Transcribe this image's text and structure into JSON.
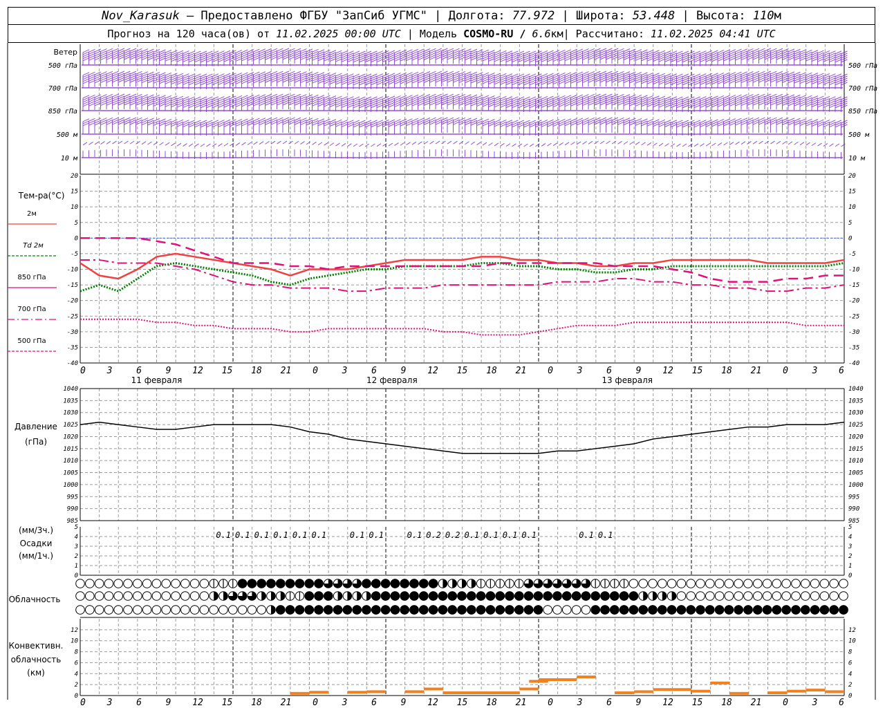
{
  "header": {
    "station": "Nov_Karasuk",
    "provider": "– Предоставлено ФГБУ \"ЗапСиб УГМС\" |",
    "lon_label": "Долгота:",
    "lon": "77.972",
    "lat_label": "| Широта:",
    "lat": "53.448",
    "alt_label": "| Высота:",
    "alt": "110",
    "alt_unit": "м",
    "forecast_label": "Прогноз на 120 часа(ов) от",
    "start": "11.02.2025 00:00 UTC",
    "model_label": " | Модель",
    "model": "COSMO-RU /",
    "resolution": "6.6",
    "res_unit": "км",
    "calc_label": " | Рассчитано:",
    "calc": "11.02.2025 04:41 UTC"
  },
  "colors": {
    "wind": "#7f2fd0",
    "t2m": "#f04040",
    "td2m": "#008000",
    "t850": "#e0107a",
    "t700": "#e0107a",
    "t500": "#e0107a",
    "pressure": "#000000",
    "precip": "#2040e0",
    "conv": "#f08020",
    "grid": "#9a9a9a",
    "zero_line": "#4060e0"
  },
  "chart_data": [
    {
      "type": "wind-barbs",
      "label": "Ветер",
      "levels": [
        {
          "name": "500 гПа",
          "dir_deg": 300,
          "speed_class": "strong"
        },
        {
          "name": "700 гПа",
          "dir_deg": 290,
          "speed_class": "strong"
        },
        {
          "name": "850 гПа",
          "dir_deg": 280,
          "speed_class": "strong"
        },
        {
          "name": "500 м",
          "dir_deg": 280,
          "speed_class": "moderate"
        },
        {
          "name": "10 м",
          "dir_deg": 250,
          "speed_class": "weak"
        }
      ]
    },
    {
      "type": "line",
      "ylabel": "Тем-ра(°С)",
      "ylim": [
        -40,
        20
      ],
      "yticks": [
        20,
        15,
        10,
        5,
        0,
        -5,
        -10,
        -15,
        -20,
        -25,
        -30,
        -35,
        -40
      ],
      "xlim": [
        0,
        120
      ],
      "xtick_labels": [
        "0",
        "3",
        "6",
        "9",
        "12",
        "15",
        "18",
        "21",
        "0",
        "3",
        "6",
        "9",
        "12",
        "15",
        "18",
        "21",
        "0",
        "3",
        "6",
        "9",
        "12",
        "15",
        "18",
        "21",
        "0",
        "3",
        "6"
      ],
      "day_labels": [
        "11 февраля",
        "12 февраля",
        "13 февраля"
      ],
      "series": [
        {
          "name": "2м",
          "style": "solid",
          "x": [
            0,
            3,
            6,
            9,
            12,
            15,
            18,
            21,
            24,
            27,
            30,
            33,
            36,
            39,
            42,
            45,
            48,
            51,
            54,
            57,
            60,
            63,
            66,
            69,
            72,
            75,
            78,
            81,
            84,
            87,
            90,
            93,
            96,
            99,
            102,
            105,
            108,
            111,
            114,
            117,
            120
          ],
          "y": [
            -8,
            -12,
            -13,
            -10,
            -6,
            -5,
            -6,
            -7,
            -8,
            -9,
            -10,
            -12,
            -10,
            -10,
            -10,
            -9,
            -8,
            -7,
            -7,
            -7,
            -7,
            -6,
            -6,
            -7,
            -7,
            -8,
            -8,
            -9,
            -9,
            -8,
            -8,
            -7,
            -7,
            -7,
            -7,
            -7,
            -8,
            -8,
            -8,
            -8,
            -7
          ]
        },
        {
          "name": "Td 2м",
          "style": "dotted",
          "x": [
            0,
            3,
            6,
            9,
            12,
            15,
            18,
            21,
            24,
            27,
            30,
            33,
            36,
            39,
            42,
            45,
            48,
            51,
            54,
            57,
            60,
            63,
            66,
            69,
            72,
            75,
            78,
            81,
            84,
            87,
            90,
            93,
            96,
            99,
            102,
            105,
            108,
            111,
            114,
            117,
            120
          ],
          "y": [
            -17,
            -15,
            -17,
            -13,
            -9,
            -8,
            -9,
            -10,
            -11,
            -12,
            -14,
            -15,
            -13,
            -12,
            -11,
            -10,
            -10,
            -9,
            -9,
            -9,
            -9,
            -8,
            -8,
            -9,
            -9,
            -10,
            -10,
            -11,
            -11,
            -10,
            -10,
            -9,
            -9,
            -9,
            -9,
            -9,
            -9,
            -9,
            -9,
            -9,
            -8
          ]
        },
        {
          "name": "850 гПа",
          "style": "dashed",
          "x": [
            0,
            3,
            6,
            9,
            12,
            15,
            18,
            21,
            24,
            27,
            30,
            33,
            36,
            39,
            42,
            45,
            48,
            51,
            54,
            57,
            60,
            63,
            66,
            69,
            72,
            75,
            78,
            81,
            84,
            87,
            90,
            93,
            96,
            99,
            102,
            105,
            108,
            111,
            114,
            117,
            120
          ],
          "y": [
            0,
            0,
            0,
            0,
            -1,
            -2,
            -4,
            -6,
            -8,
            -8,
            -8,
            -9,
            -9,
            -10,
            -9,
            -9,
            -9,
            -9,
            -9,
            -9,
            -9,
            -9,
            -8,
            -8,
            -8,
            -8,
            -8,
            -8,
            -9,
            -9,
            -9,
            -10,
            -11,
            -13,
            -14,
            -14,
            -14,
            -13,
            -13,
            -12,
            -12
          ]
        },
        {
          "name": "700 гПа",
          "style": "dashdot",
          "x": [
            0,
            3,
            6,
            9,
            12,
            15,
            18,
            21,
            24,
            27,
            30,
            33,
            36,
            39,
            42,
            45,
            48,
            51,
            54,
            57,
            60,
            63,
            66,
            69,
            72,
            75,
            78,
            81,
            84,
            87,
            90,
            93,
            96,
            99,
            102,
            105,
            108,
            111,
            114,
            117,
            120
          ],
          "y": [
            -7,
            -7,
            -8,
            -8,
            -8,
            -9,
            -10,
            -12,
            -14,
            -15,
            -15,
            -16,
            -16,
            -16,
            -17,
            -17,
            -16,
            -16,
            -16,
            -15,
            -15,
            -15,
            -15,
            -15,
            -15,
            -14,
            -14,
            -14,
            -13,
            -13,
            -14,
            -14,
            -15,
            -15,
            -16,
            -16,
            -17,
            -17,
            -16,
            -16,
            -15
          ]
        },
        {
          "name": "500 гПа",
          "style": "dotted",
          "x": [
            0,
            3,
            6,
            9,
            12,
            15,
            18,
            21,
            24,
            27,
            30,
            33,
            36,
            39,
            42,
            45,
            48,
            51,
            54,
            57,
            60,
            63,
            66,
            69,
            72,
            75,
            78,
            81,
            84,
            87,
            90,
            93,
            96,
            99,
            102,
            105,
            108,
            111,
            114,
            117,
            120
          ],
          "y": [
            -26,
            -26,
            -26,
            -26,
            -27,
            -27,
            -28,
            -28,
            -29,
            -29,
            -29,
            -30,
            -30,
            -29,
            -29,
            -29,
            -29,
            -29,
            -29,
            -30,
            -30,
            -31,
            -31,
            -31,
            -30,
            -29,
            -28,
            -28,
            -28,
            -27,
            -27,
            -27,
            -27,
            -27,
            -27,
            -27,
            -27,
            -27,
            -28,
            -28,
            -28
          ]
        }
      ]
    },
    {
      "type": "line",
      "ylabel": "Давление",
      "yunit": "(гПа)",
      "ylim": [
        985,
        1040
      ],
      "yticks": [
        1040,
        1035,
        1030,
        1025,
        1020,
        1015,
        1010,
        1005,
        1000,
        995,
        990,
        985
      ],
      "series": [
        {
          "name": "pressure",
          "x": [
            0,
            3,
            6,
            9,
            12,
            15,
            18,
            21,
            24,
            27,
            30,
            33,
            36,
            39,
            42,
            45,
            48,
            51,
            54,
            57,
            60,
            63,
            66,
            69,
            72,
            75,
            78,
            81,
            84,
            87,
            90,
            93,
            96,
            99,
            102,
            105,
            108,
            111,
            114,
            117,
            120
          ],
          "y": [
            1025,
            1026,
            1025,
            1024,
            1023,
            1023,
            1024,
            1025,
            1025,
            1025,
            1025,
            1024,
            1022,
            1021,
            1019,
            1018,
            1017,
            1016,
            1015,
            1014,
            1013,
            1013,
            1013,
            1013,
            1013,
            1014,
            1014,
            1015,
            1016,
            1017,
            1019,
            1020,
            1021,
            1022,
            1023,
            1024,
            1024,
            1025,
            1025,
            1025,
            1026
          ]
        }
      ]
    },
    {
      "type": "bar",
      "ylabel_top": "(мм/3ч.)",
      "ylabel": "Осадки",
      "ylabel_bottom": "(мм/1ч.)",
      "ylim": [
        0,
        5
      ],
      "yticks": [
        5,
        4,
        3,
        2,
        1,
        0
      ],
      "x": [
        21,
        24,
        27,
        30,
        33,
        36,
        42,
        45,
        51,
        54,
        57,
        60,
        63,
        66,
        69,
        78,
        81
      ],
      "values": [
        0.1,
        0.1,
        0.1,
        0.1,
        0.1,
        0.1,
        0.1,
        0.1,
        0.1,
        0.2,
        0.2,
        0.1,
        0.1,
        0.1,
        0.1,
        0.1,
        0.1
      ],
      "labels": [
        "0.1",
        "0.1",
        "0.1",
        "0.1",
        "0.1",
        "0.1",
        "0.1",
        "0.1",
        "0.1",
        "0.2",
        "0.2",
        "0.1",
        "0.1",
        "0.1",
        "0.1",
        "0.1",
        "0.1"
      ]
    },
    {
      "type": "cloud-cover",
      "ylabel": "Облачность",
      "rows": [
        "high",
        "middle",
        "low"
      ],
      "step_hours": 1.5,
      "segments": {
        "high": [
          [
            0,
            0,
            20
          ],
          [
            1,
            21,
            25
          ],
          [
            4,
            25,
            38
          ],
          [
            3,
            38,
            45
          ],
          [
            4,
            45,
            56
          ],
          [
            2,
            56,
            63
          ],
          [
            1,
            63,
            70
          ],
          [
            3,
            70,
            80
          ],
          [
            1,
            80,
            87
          ],
          [
            0,
            87,
            120
          ]
        ],
        "middle": [
          [
            0,
            0,
            20
          ],
          [
            2,
            20,
            24
          ],
          [
            3,
            24,
            28
          ],
          [
            2,
            28,
            33
          ],
          [
            1,
            33,
            36
          ],
          [
            4,
            36,
            40
          ],
          [
            2,
            40,
            46
          ],
          [
            4,
            46,
            88
          ],
          [
            2,
            88,
            94
          ],
          [
            0,
            94,
            120
          ]
        ],
        "low": [
          [
            0,
            0,
            30
          ],
          [
            2,
            30,
            31
          ],
          [
            4,
            31,
            73
          ],
          [
            0,
            73,
            80
          ],
          [
            1,
            80,
            81
          ],
          [
            4,
            81,
            120
          ]
        ]
      }
    },
    {
      "type": "bar",
      "ylabel": "Конвективн.",
      "ylabel2": "облачность",
      "yunit": "(км)",
      "ylim": [
        0,
        14
      ],
      "yticks": [
        12,
        10,
        8,
        6,
        4,
        2,
        0
      ],
      "intervals": [
        [
          33,
          0.4
        ],
        [
          36,
          0.6
        ],
        [
          42,
          0.6
        ],
        [
          45,
          0.7
        ],
        [
          51,
          0.7
        ],
        [
          54,
          1.2
        ],
        [
          57,
          0.5
        ],
        [
          60,
          0.5
        ],
        [
          63,
          0.5
        ],
        [
          66,
          0.5
        ],
        [
          69,
          1.2
        ],
        [
          70.5,
          2.6
        ],
        [
          72,
          2.9
        ],
        [
          75,
          2.9
        ],
        [
          78,
          3.4
        ],
        [
          84,
          0.5
        ],
        [
          87,
          0.7
        ],
        [
          90,
          1.1
        ],
        [
          93,
          1.1
        ],
        [
          96,
          0.8
        ],
        [
          99,
          2.3
        ],
        [
          102,
          0.4
        ],
        [
          108,
          0.5
        ],
        [
          111,
          0.8
        ],
        [
          114,
          1.0
        ],
        [
          117,
          0.7
        ]
      ]
    }
  ]
}
